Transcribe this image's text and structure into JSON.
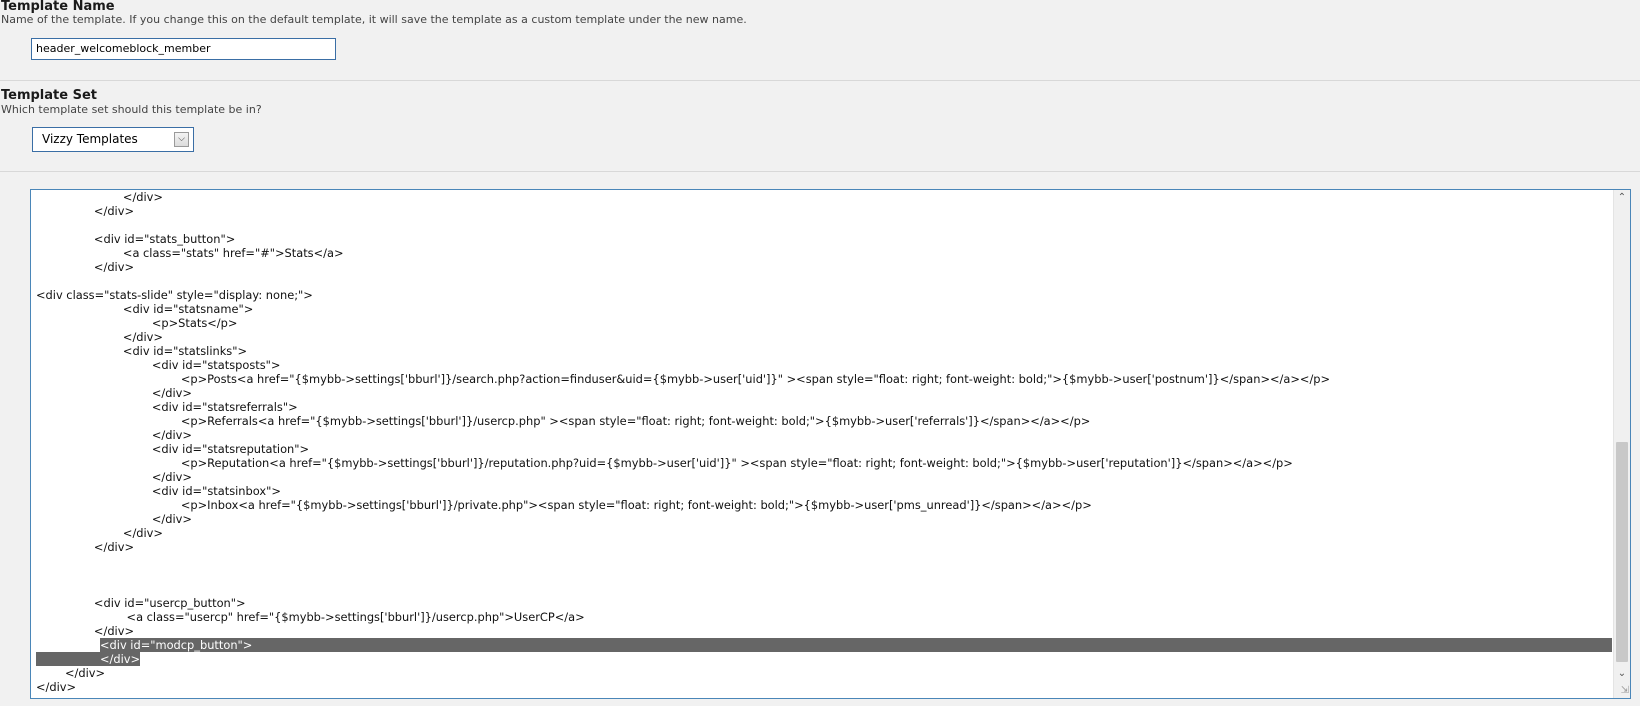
{
  "template_name": {
    "title": "Template Name",
    "description": "Name of the template. If you change this on the default template, it will save the template as a custom template under the new name.",
    "value": "header_welcomeblock_member"
  },
  "template_set": {
    "title": "Template Set",
    "description": "Which template set should this template be in?",
    "selected": "Vizzy Templates",
    "arrow_icon": "chevron-down-icon"
  },
  "editor": {
    "lines": [
      "\t\t\t</div>",
      "\t\t</div>",
      "",
      "\t\t<div id=\"stats_button\">",
      "\t\t\t<a class=\"stats\" href=\"#\">Stats</a>",
      "\t\t</div>",
      "",
      "<div class=\"stats-slide\" style=\"display: none;\">",
      "\t\t\t<div id=\"statsname\">",
      "\t\t\t\t<p>Stats</p>",
      "\t\t\t</div>",
      "\t\t\t<div id=\"statslinks\">",
      "\t\t\t\t<div id=\"statsposts\">",
      "\t\t\t\t\t<p>Posts<a href=\"{$mybb->settings['bburl']}/search.php?action=finduser&uid={$mybb->user['uid']}\" ><span style=\"float: right; font-weight: bold;\">{$mybb->user['postnum']}</span></a></p>",
      "\t\t\t\t</div>",
      "\t\t\t\t<div id=\"statsreferrals\">",
      "\t\t\t\t\t<p>Referrals<a href=\"{$mybb->settings['bburl']}/usercp.php\" ><span style=\"float: right; font-weight: bold;\">{$mybb->user['referrals']}</span></a></p>",
      "\t\t\t\t</div>",
      "\t\t\t\t<div id=\"statsreputation\">",
      "\t\t\t\t\t<p>Reputation<a href=\"{$mybb->settings['bburl']}/reputation.php?uid={$mybb->user['uid']}\" ><span style=\"float: right; font-weight: bold;\">{$mybb->user['reputation']}</span></a></p>",
      "\t\t\t\t</div>",
      "\t\t\t\t<div id=\"statsinbox\">",
      "\t\t\t\t\t<p>Inbox<a href=\"{$mybb->settings['bburl']}/private.php\"><span style=\"float: right; font-weight: bold;\">{$mybb->user['pms_unread']}</span></a></p>",
      "\t\t\t\t</div>",
      "\t\t\t</div>",
      "\t\t</div>",
      "",
      "",
      "",
      "\t\t<div id=\"usercp_button\">",
      "\t\t\t <a class=\"usercp\" href=\"{$mybb->settings['bburl']}/usercp.php\">UserCP</a>",
      "\t\t</div>"
    ],
    "selected_line_1": "<div id=\"modcp_button\">",
    "selected_line_2": "</div>",
    "after_lines": [
      "\t</div>",
      "</div>"
    ],
    "scroll_up_icon": "scroll-up-arrow-icon",
    "scroll_down_icon": "scroll-down-arrow-icon",
    "resize_icon": "resize-grip-icon"
  }
}
